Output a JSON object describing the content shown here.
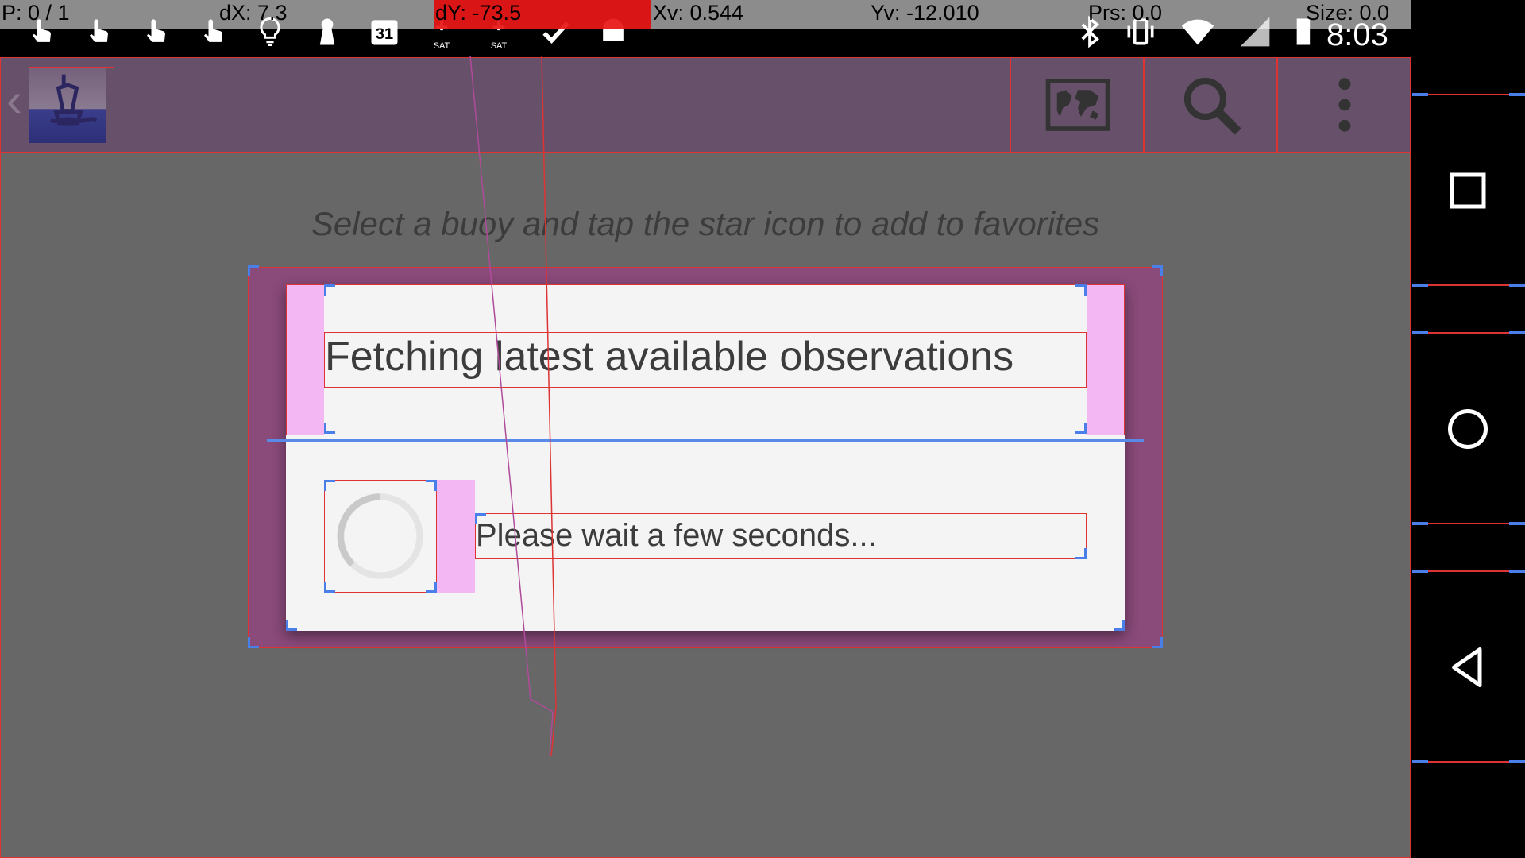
{
  "pointer_location": {
    "pointers": "P: 0 / 1",
    "dx": "dX: 7.3",
    "dy": "dY: -73.5",
    "xv": "Xv: 0.544",
    "yv": "Yv: -12.010",
    "prs": "Prs: 0.0",
    "size": "Size: 0.0"
  },
  "status_bar": {
    "calendar_day": "31",
    "sat_label": "SAT",
    "clock": "8:03"
  },
  "action_bar": {
    "back_glyph": "‹",
    "map_icon": "world-map-icon",
    "search_icon": "search-icon",
    "overflow_icon": "overflow-menu-icon"
  },
  "content": {
    "hint": "Select a buoy and tap the star icon to add to favorites"
  },
  "dialog": {
    "title": "Fetching latest available observations",
    "message": "Please wait a few seconds..."
  },
  "colors": {
    "action_bar": "#67506a",
    "content_bg": "#676767",
    "dialog_bg": "#f4f4f4",
    "bounds_red": "#dd3333",
    "bounds_blue": "#4a7ee8",
    "margin_pink": "#f3b8f3"
  }
}
